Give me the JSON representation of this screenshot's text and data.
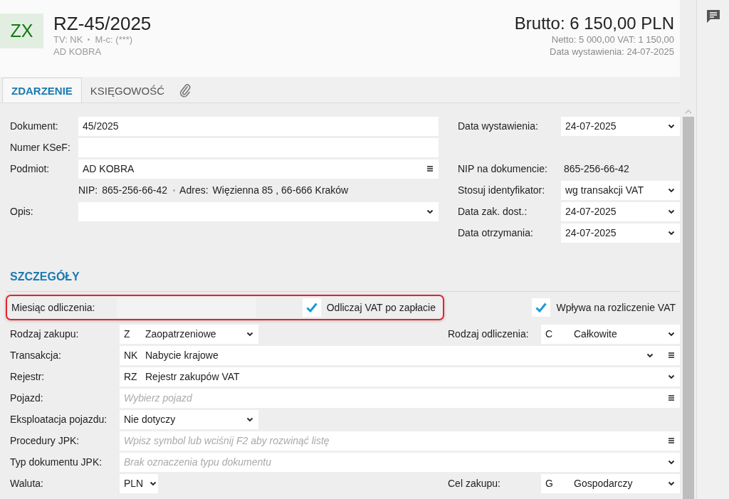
{
  "header": {
    "badge": "ZX",
    "title": "RZ-45/2025",
    "meta": [
      "TV: NK",
      "M-c: (***)"
    ],
    "contractor": "AD KOBRA",
    "gross": "Brutto: 6 150,00 PLN",
    "net_vat": "Netto: 5 000,00 VAT: 1 150,00",
    "issue_date": "Data wystawienia: 24-07-2025"
  },
  "tabs": [
    {
      "kind": "text",
      "label": "ZDARZENIE",
      "selected": true
    },
    {
      "kind": "text",
      "label": "KSIĘGOWOŚĆ",
      "selected": false
    },
    {
      "kind": "attachment",
      "selected": false
    }
  ],
  "main_left": [
    {
      "kind": "text",
      "label": "Dokument:",
      "value": "45/2025"
    },
    {
      "kind": "text",
      "label": "Numer KSeF:"
    },
    {
      "kind": "lookup",
      "label": "Podmiot:",
      "value": "AD KOBRA"
    },
    {
      "kind": "info",
      "parts": [
        "NIP:",
        "865-256-66-42",
        "Adres:",
        "Więzienna  85 , 66-666 Kraków"
      ]
    },
    {
      "kind": "select",
      "label": "Opis:"
    }
  ],
  "main_right": [
    {
      "kind": "select",
      "label": "Data wystawienia:",
      "value": "24-07-2025"
    },
    {
      "kind": "static",
      "label": "NIP na dokumencie:",
      "value": "865-256-66-42"
    },
    {
      "kind": "select",
      "label": "Stosuj identyfikator:",
      "value": "wg transakcji VAT"
    },
    {
      "kind": "select",
      "label": "Data zak. dost.:",
      "value": "24-07-2025"
    },
    {
      "kind": "select",
      "label": "Data otrzymania:",
      "value": "24-07-2025"
    }
  ],
  "details": {
    "heading": "SZCZEGÓŁY",
    "deduction_month": {
      "label": "Miesiąc odliczenia:"
    },
    "checkboxes": [
      {
        "label": "Odliczaj VAT po zapłacie",
        "checked": true
      },
      {
        "label": "Wpływa na rozliczenie VAT",
        "checked": true
      }
    ],
    "rows": [
      {
        "kind": "short-select",
        "label": "Rodzaj zakupu:",
        "code": "Z",
        "value": "Zaopatrzeniowe",
        "right": {
          "label": "Rodzaj odliczenia:",
          "code": "C",
          "value": "Całkowite"
        }
      },
      {
        "kind": "combo",
        "label": "Transakcja:",
        "code": "NK",
        "value": "Nabycie krajowe"
      },
      {
        "kind": "select",
        "label": "Rejestr:",
        "code": "RZ",
        "value": "Rejestr zakupów VAT"
      },
      {
        "kind": "lookup",
        "label": "Pojazd:",
        "placeholder": "Wybierz pojazd"
      },
      {
        "kind": "short-select",
        "label": "Eksploatacja pojazdu:",
        "value": "Nie dotyczy"
      },
      {
        "kind": "lookup",
        "label": "Procedury JPK:",
        "placeholder": "Wpisz symbol lub wciśnij F2 aby rozwinąć listę"
      },
      {
        "kind": "select",
        "label": "Typ dokumentu JPK:",
        "placeholder": "Brak oznaczenia typu dokumentu"
      },
      {
        "kind": "mini-select",
        "label": "Waluta:",
        "value": "PLN",
        "right": {
          "label": "Cel zakupu:",
          "code": "G",
          "value": "Gospodarczy"
        }
      }
    ]
  }
}
